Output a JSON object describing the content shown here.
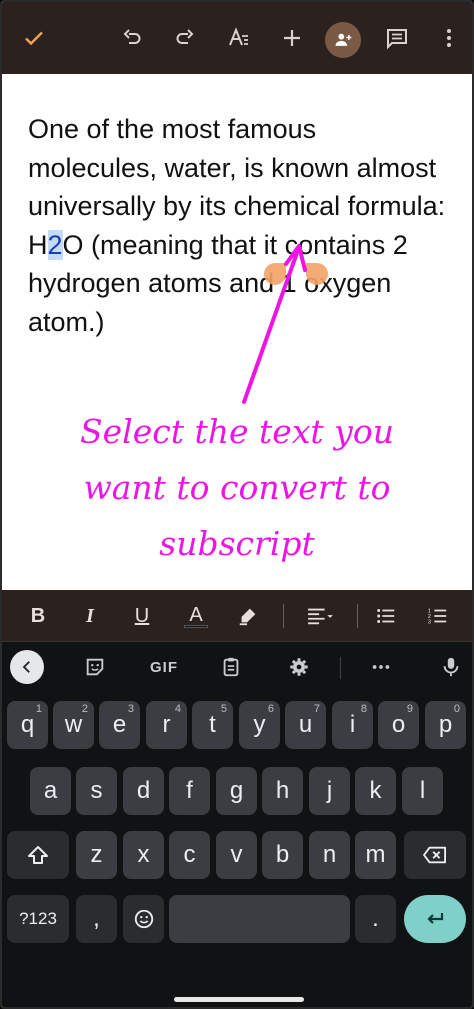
{
  "appbar": {
    "icons": [
      "check-icon",
      "undo-icon",
      "redo-icon",
      "text-format-icon",
      "add-icon",
      "share-person-icon",
      "comment-icon",
      "more-vert-icon"
    ]
  },
  "document": {
    "text_before": "One of the most famous molecules, water, is known almost universally by its chemical formula: H",
    "selected_text": "2",
    "text_after": "O (meaning that it contains 2 hydrogen atoms and 1 oxygen atom.)"
  },
  "annotation": {
    "line1": "Select the text you",
    "line2": "want to convert to",
    "line3": "subscript",
    "color": "#ee14e5"
  },
  "format_toolbar": {
    "bold": "B",
    "italic": "I",
    "underline": "U",
    "text_color": "A",
    "icons": [
      "highlighter-icon",
      "align-left-icon",
      "bulleted-list-icon",
      "numbered-list-icon"
    ]
  },
  "keyboard": {
    "suggestion_gif": "GIF",
    "row1": [
      {
        "k": "q",
        "h": "1"
      },
      {
        "k": "w",
        "h": "2"
      },
      {
        "k": "e",
        "h": "3"
      },
      {
        "k": "r",
        "h": "4"
      },
      {
        "k": "t",
        "h": "5"
      },
      {
        "k": "y",
        "h": "6"
      },
      {
        "k": "u",
        "h": "7"
      },
      {
        "k": "i",
        "h": "8"
      },
      {
        "k": "o",
        "h": "9"
      },
      {
        "k": "p",
        "h": "0"
      }
    ],
    "row2": [
      "a",
      "s",
      "d",
      "f",
      "g",
      "h",
      "j",
      "k",
      "l"
    ],
    "row3": [
      "z",
      "x",
      "c",
      "v",
      "b",
      "n",
      "m"
    ],
    "symbols": "?123",
    "comma": ",",
    "period": ".",
    "enter_color": "#7ed0c8"
  }
}
